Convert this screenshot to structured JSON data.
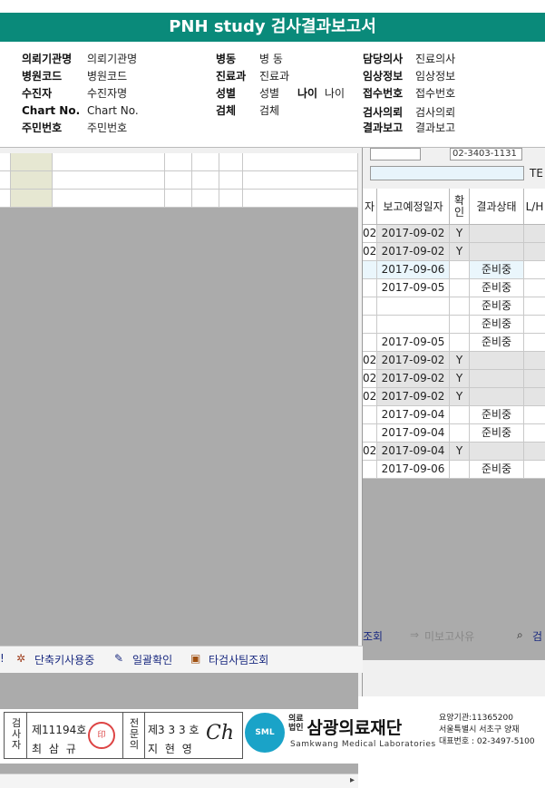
{
  "title": "PNH study 검사결과보고서",
  "info": {
    "c1": [
      {
        "label": "의뢰기관명",
        "value": "의뢰기관명"
      },
      {
        "label": "병원코드",
        "value": "병원코드"
      },
      {
        "label": "수진자",
        "value": "수진자명"
      },
      {
        "label": "Chart No.",
        "value": "Chart No."
      },
      {
        "label": "주민번호",
        "value": "주민번호"
      }
    ],
    "c2": [
      {
        "label": "병동",
        "value": "병 동"
      },
      {
        "label": "진료과",
        "value": "진료과"
      },
      {
        "label": "성별",
        "value": "성별"
      },
      {
        "label": "검체",
        "value": "검체"
      }
    ],
    "age": {
      "label": "나이",
      "value": "나이"
    },
    "c3": [
      {
        "label": "담당의사",
        "value": "진료의사"
      },
      {
        "label": "임상정보",
        "value": "임상정보"
      },
      {
        "label": "접수번호",
        "value": "접수번호"
      },
      {
        "label": "검사의뢰",
        "value": "검사의뢰"
      },
      {
        "label": "결과보고",
        "value": "결과보고"
      }
    ]
  },
  "right_header": {
    "col_prefix": "자",
    "col_date": "보고예정일자",
    "col_confirm": "확인",
    "col_status": "결과상태",
    "col_lh": "L/H",
    "tel_label": "TE",
    "phone_partial": "02-3403-1131"
  },
  "rows": [
    {
      "prefix": "02",
      "date": "2017-09-02",
      "confirm": "Y",
      "status": ""
    },
    {
      "prefix": "02",
      "date": "2017-09-02",
      "confirm": "Y",
      "status": ""
    },
    {
      "prefix": "",
      "date": "2017-09-06",
      "confirm": "",
      "status": "준비중"
    },
    {
      "prefix": "",
      "date": "2017-09-05",
      "confirm": "",
      "status": "준비중"
    },
    {
      "prefix": "",
      "date": "",
      "confirm": "",
      "status": "준비중"
    },
    {
      "prefix": "",
      "date": "",
      "confirm": "",
      "status": "준비중"
    },
    {
      "prefix": "",
      "date": "2017-09-05",
      "confirm": "",
      "status": "준비중"
    },
    {
      "prefix": "02",
      "date": "2017-09-02",
      "confirm": "Y",
      "status": ""
    },
    {
      "prefix": "02",
      "date": "2017-09-02",
      "confirm": "Y",
      "status": ""
    },
    {
      "prefix": "02",
      "date": "2017-09-02",
      "confirm": "Y",
      "status": ""
    },
    {
      "prefix": "",
      "date": "2017-09-04",
      "confirm": "",
      "status": "준비중"
    },
    {
      "prefix": "",
      "date": "2017-09-04",
      "confirm": "",
      "status": "준비중"
    },
    {
      "prefix": "02",
      "date": "2017-09-04",
      "confirm": "Y",
      "status": ""
    },
    {
      "prefix": "",
      "date": "2017-09-06",
      "confirm": "",
      "status": "준비중"
    }
  ],
  "right_toolbar": {
    "lookup": "조회",
    "unreported": "미보고사유",
    "search": "검"
  },
  "toolbar": {
    "shortcut": "단축키사용중",
    "batch_confirm": "일괄확인",
    "other_team": "타검사팀조회"
  },
  "footer": {
    "inspector_label": "검사자",
    "inspector_no": "제11194호",
    "inspector_name": "최 삼 규",
    "doctor_label": "전문의",
    "doctor_no": "제3 3 3 호",
    "doctor_name": "지 현 영",
    "logo_text": "SML",
    "corp_label_1": "의료",
    "corp_label_2": "법인",
    "org_name": "삼광의료재단",
    "org_en": "Samkwang Medical Laboratories",
    "contact_1": "요양기관:11365200",
    "contact_2": "서울특별시 서초구 양재",
    "contact_3": "대표번호 : 02-3497-5100"
  }
}
